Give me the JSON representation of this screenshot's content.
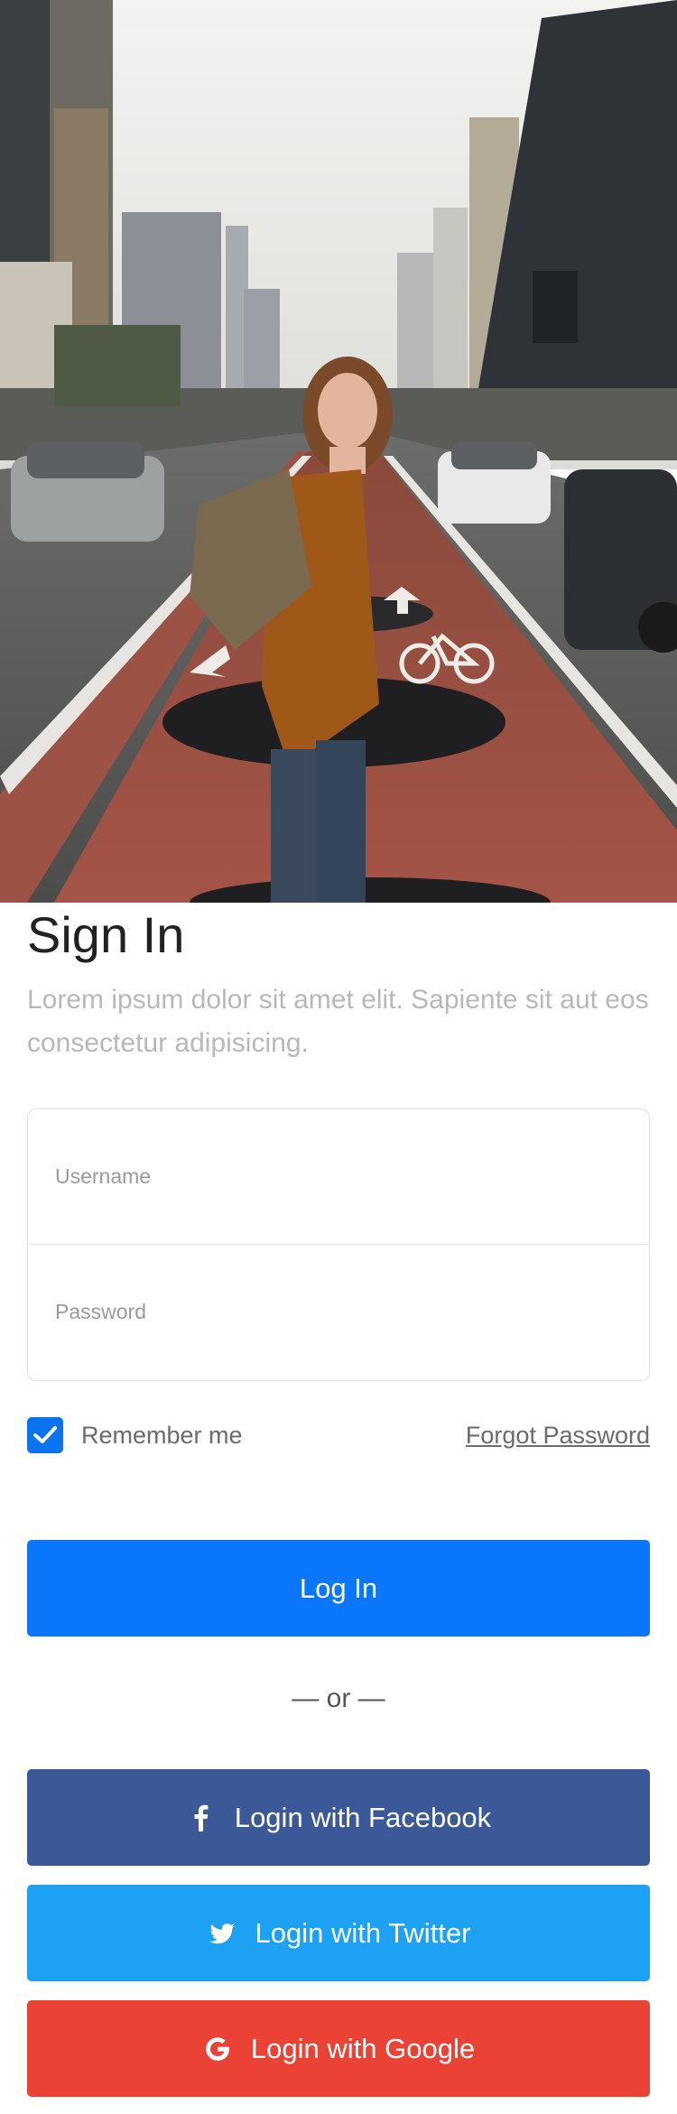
{
  "hero": {
    "image": "city-street-woman-backpack-photo"
  },
  "signin": {
    "title": "Sign In",
    "subtitle": "Lorem ipsum dolor sit amet elit. Sapiente sit aut eos consectetur adipisicing."
  },
  "form": {
    "username_placeholder": "Username",
    "username_value": "",
    "password_placeholder": "Password",
    "password_value": "",
    "remember_label": "Remember me",
    "remember_checked": true,
    "forgot_label": "Forgot Password"
  },
  "buttons": {
    "login_label": "Log In",
    "divider_label": "— or —",
    "facebook_label": "Login with Facebook",
    "twitter_label": "Login with Twitter",
    "google_label": "Login with Google"
  },
  "icons": {
    "check": "check-icon",
    "facebook": "facebook-icon",
    "twitter": "twitter-icon",
    "google": "google-icon"
  },
  "colors": {
    "primary": "#0a77fb",
    "facebook": "#3b5998",
    "twitter": "#1da1f2",
    "google": "#ea4335",
    "checkbox": "#0a74f0"
  }
}
